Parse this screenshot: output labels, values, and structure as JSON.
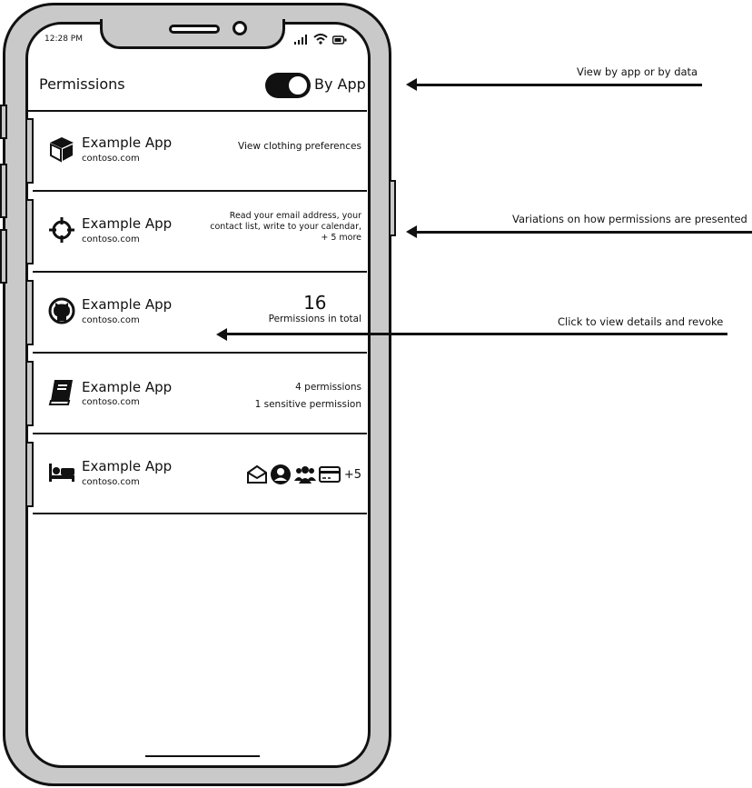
{
  "status_bar": {
    "time": "12:28 PM"
  },
  "header": {
    "title": "Permissions",
    "toggle_label": "By App",
    "toggle_on": true
  },
  "apps": [
    {
      "name": "Example App",
      "domain": "contoso.com",
      "icon": "box-icon",
      "permission_text": "View clothing preferences"
    },
    {
      "name": "Example App",
      "domain": "contoso.com",
      "icon": "crosshair-icon",
      "permission_lines": [
        "Read your email address, your",
        "contact list, write to your calendar,",
        "+ 5 more"
      ]
    },
    {
      "name": "Example App",
      "domain": "contoso.com",
      "icon": "github-icon",
      "permission_count": "16",
      "permission_count_label": "Permissions in total"
    },
    {
      "name": "Example App",
      "domain": "contoso.com",
      "icon": "book-icon",
      "permission_lines": [
        "4 permissions",
        "1 sensitive permission"
      ]
    },
    {
      "name": "Example App",
      "domain": "contoso.com",
      "icon": "bed-icon",
      "permission_icons": [
        "mail-open-icon",
        "user-circle-icon",
        "users-icon",
        "credit-card-icon"
      ],
      "more_label": "+5"
    }
  ],
  "annotations": [
    {
      "text": "View by app or by data"
    },
    {
      "text": "Variations on how permissions are presented"
    },
    {
      "text": "Click to view details and revoke"
    }
  ]
}
